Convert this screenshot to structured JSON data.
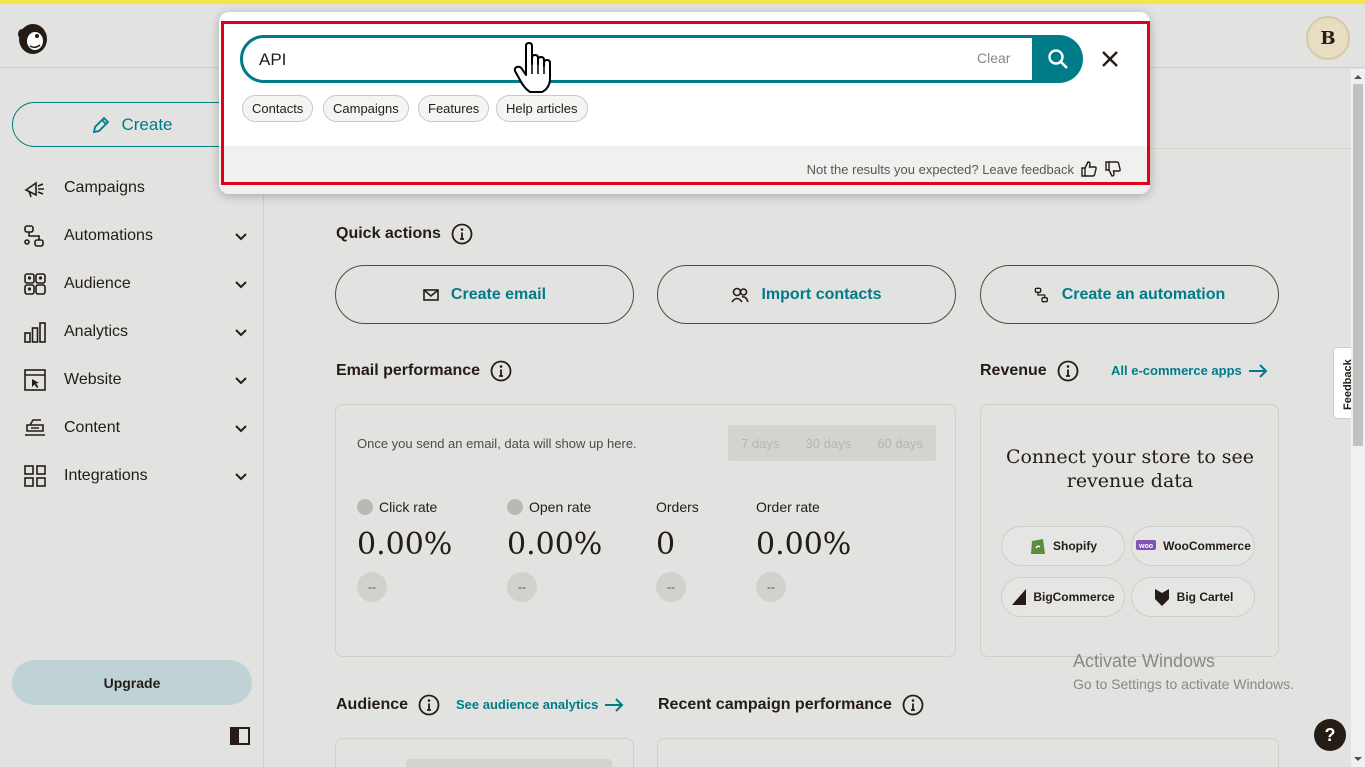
{
  "colors": {
    "accent": "#007c89",
    "highlight": "#e0001a",
    "brand_bar": "#f5e44a"
  },
  "header": {
    "logo_icon": "mailchimp-freddie-icon",
    "avatar_initial": "B"
  },
  "sidebar": {
    "create_label": "Create",
    "items": [
      {
        "label": "Campaigns",
        "icon": "megaphone-icon",
        "has_chevron": false
      },
      {
        "label": "Automations",
        "icon": "automation-flow-icon",
        "has_chevron": true
      },
      {
        "label": "Audience",
        "icon": "audience-icon",
        "has_chevron": true
      },
      {
        "label": "Analytics",
        "icon": "bar-chart-icon",
        "has_chevron": true
      },
      {
        "label": "Website",
        "icon": "website-icon",
        "has_chevron": true
      },
      {
        "label": "Content",
        "icon": "content-icon",
        "has_chevron": true
      },
      {
        "label": "Integrations",
        "icon": "integrations-grid-icon",
        "has_chevron": true
      }
    ],
    "upgrade_label": "Upgrade"
  },
  "search": {
    "query": "API",
    "clear_label": "Clear",
    "filters": [
      "Contacts",
      "Campaigns",
      "Features",
      "Help articles"
    ],
    "feedback_text": "Not the results you expected? Leave feedback"
  },
  "quick_actions": {
    "title": "Quick actions",
    "buttons": [
      "Create email",
      "Import contacts",
      "Create an automation"
    ]
  },
  "email_performance": {
    "title": "Email performance",
    "empty_text": "Once you send an email, data will show up here.",
    "ranges": [
      "7 days",
      "30 days",
      "60 days"
    ],
    "metrics": [
      {
        "label": "Click rate",
        "value": "0.00%",
        "change": "--"
      },
      {
        "label": "Open rate",
        "value": "0.00%",
        "change": "--"
      },
      {
        "label": "Orders",
        "value": "0",
        "change": "--"
      },
      {
        "label": "Order rate",
        "value": "0.00%",
        "change": "--"
      }
    ]
  },
  "revenue": {
    "title": "Revenue",
    "link": "All e-commerce apps",
    "heading": "Connect your store to see revenue data",
    "stores": [
      "Shopify",
      "WooCommerce",
      "BigCommerce",
      "Big Cartel"
    ]
  },
  "audience": {
    "title": "Audience",
    "link": "See audience analytics"
  },
  "recent": {
    "title": "Recent campaign performance"
  },
  "feedback_tab": "Feedback",
  "windows": {
    "line1": "Activate Windows",
    "line2": "Go to Settings to activate Windows."
  },
  "help_label": "?"
}
